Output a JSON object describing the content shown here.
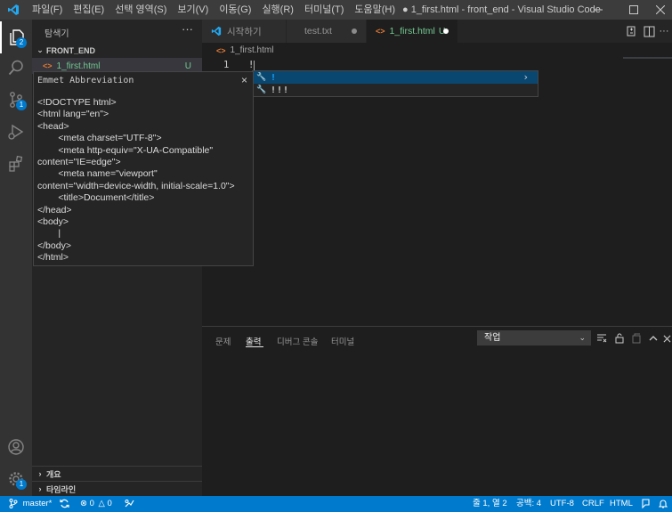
{
  "window": {
    "title": "● 1_first.html - front_end - Visual Studio Code",
    "menu": [
      "파일(F)",
      "편집(E)",
      "선택 영역(S)",
      "보기(V)",
      "이동(G)",
      "실행(R)",
      "터미널(T)",
      "도움말(H)"
    ]
  },
  "activity_bar": {
    "items": [
      {
        "icon": "files-icon",
        "badge": "2"
      },
      {
        "icon": "search-icon",
        "badge": ""
      },
      {
        "icon": "source-control-icon",
        "badge": "1"
      },
      {
        "icon": "run-debug-icon",
        "badge": ""
      },
      {
        "icon": "extensions-icon",
        "badge": ""
      }
    ],
    "bottom": [
      {
        "icon": "account-icon"
      },
      {
        "icon": "settings-gear-icon",
        "badge": "1"
      }
    ]
  },
  "sidebar": {
    "title": "탐색기",
    "more": "···",
    "folder": "FRONT_END",
    "file": {
      "icon": "<>",
      "name": "1_first.html",
      "status": "U"
    },
    "outline_label": "개요",
    "timeline_label": "타임라인"
  },
  "emmet": {
    "title": "Emmet Abbreviation",
    "close": "×",
    "body": "<!DOCTYPE html>\n<html lang=\"en\">\n<head>\n        <meta charset=\"UTF-8\">\n        <meta http-equiv=\"X-UA-Compatible\"\ncontent=\"IE=edge\">\n        <meta name=\"viewport\"\ncontent=\"width=device-width, initial-scale=1.0\">\n        <title>Document</title>\n</head>\n<body>\n        |\n</body>\n</html>"
  },
  "tabs": [
    {
      "label": "시작하기",
      "icon": "vscode-icon"
    },
    {
      "label": "test.txt",
      "icon": "text-file-icon"
    },
    {
      "label": "1_first.html",
      "suffix": "U",
      "icon": "html-icon"
    }
  ],
  "editor": {
    "breadcrumb": "1_first.html",
    "line_number": "1",
    "line_text": "!"
  },
  "suggest": {
    "items": [
      {
        "label": "!"
      },
      {
        "label": "!!!"
      }
    ]
  },
  "panel": {
    "tabs": [
      "문제",
      "출력",
      "디버그 콘솔",
      "터미널"
    ],
    "active_tab": "출력",
    "task_select": "작업"
  },
  "status_bar": {
    "branch": "master*",
    "errors": "0",
    "warnings": "0",
    "position": "줄 1, 열 2",
    "spaces": "공백: 4",
    "encoding": "UTF-8",
    "eol": "CRLF",
    "language": "HTML"
  },
  "colors": {
    "accent": "#007acc",
    "untracked": "#73c991",
    "selection": "#094771"
  }
}
